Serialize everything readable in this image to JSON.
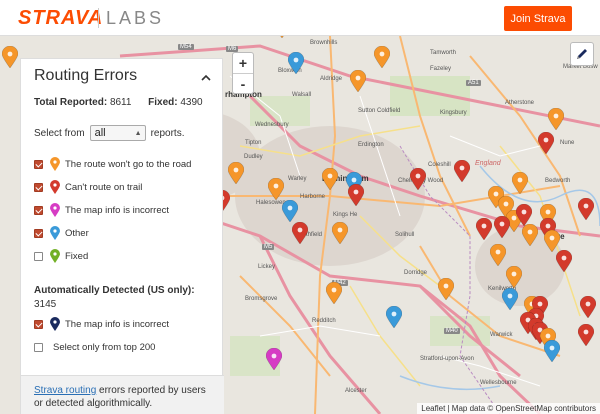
{
  "header": {
    "logo": "STRAVA",
    "sublogo": "LABS",
    "join_button": "Join Strava"
  },
  "map": {
    "zoom_in": "+",
    "zoom_out": "-",
    "attribution": "Leaflet | Map data © OpenStreetMap contributors",
    "labels": {
      "brownhills": "Brownhills",
      "tamworth": "Tamworth",
      "bloxwich": "Bloxwich",
      "aldridge": "Aldridge",
      "fazeley": "Fazeley",
      "wolverhampton": "rhampton",
      "walsall": "Walsall",
      "sutton": "Sutton Coldfield",
      "kingsbury": "Kingsbury",
      "atherstone": "Atherstone",
      "wednesbury": "Wednesbury",
      "tipton": "Tipton",
      "erdington": "Erdington",
      "nuneaton": "Nune",
      "dudley": "Dudley",
      "coleshill": "Coleshill",
      "england": "England",
      "bedworth": "Bedworth",
      "birmingham": "Birmingham",
      "warley": "Warley",
      "harborne": "Harborne",
      "chelmsley": "Chelmsley Wood",
      "halesowen": "Halesowen",
      "solihull": "Solihull",
      "kings_heath": "Kings He",
      "northfield": "rthfield",
      "coventry": "Cove",
      "kenilworth": "Kenilworth",
      "bromsgrove": "Bromsgrove",
      "redditch": "Redditch",
      "warwick": "Warwick",
      "alcester": "Alcester",
      "wellesbourne": "Wellesbourne",
      "market_bosworth": "Market Bosw",
      "stratford": "Stratford-upon-Avon",
      "dorridge": "Dorridge",
      "lickey": "Lickey"
    },
    "roads": {
      "m54": "M54",
      "m6": "M6",
      "m5": "M5",
      "m42": "M42",
      "m40": "M40",
      "a51": "A51"
    }
  },
  "panel": {
    "title": "Routing Errors",
    "total_label": "Total Reported:",
    "total_value": "8611",
    "fixed_label": "Fixed:",
    "fixed_value": "4390",
    "select_prefix": "Select from",
    "select_value": "all",
    "select_suffix": "reports.",
    "filters": [
      {
        "label": "The route won't go to the road",
        "checked": true,
        "color": "#f5962a"
      },
      {
        "label": "Can't route on trail",
        "checked": true,
        "color": "#d33a2c"
      },
      {
        "label": "The map info is incorrect",
        "checked": true,
        "color": "#d63cc4"
      },
      {
        "label": "Other",
        "checked": true,
        "color": "#3a9ad9"
      },
      {
        "label": "Fixed",
        "checked": false,
        "color": "#72b026"
      }
    ],
    "auto_title": "Automatically Detected (US only):",
    "auto_count": "3145",
    "auto_filter": {
      "label": "The map info is incorrect",
      "checked": true,
      "color": "#1a2a5e"
    },
    "top200_label": "Select only from top 200",
    "footer_link": "Strava routing",
    "footer_text": " errors reported by users or detected algorithmically."
  }
}
